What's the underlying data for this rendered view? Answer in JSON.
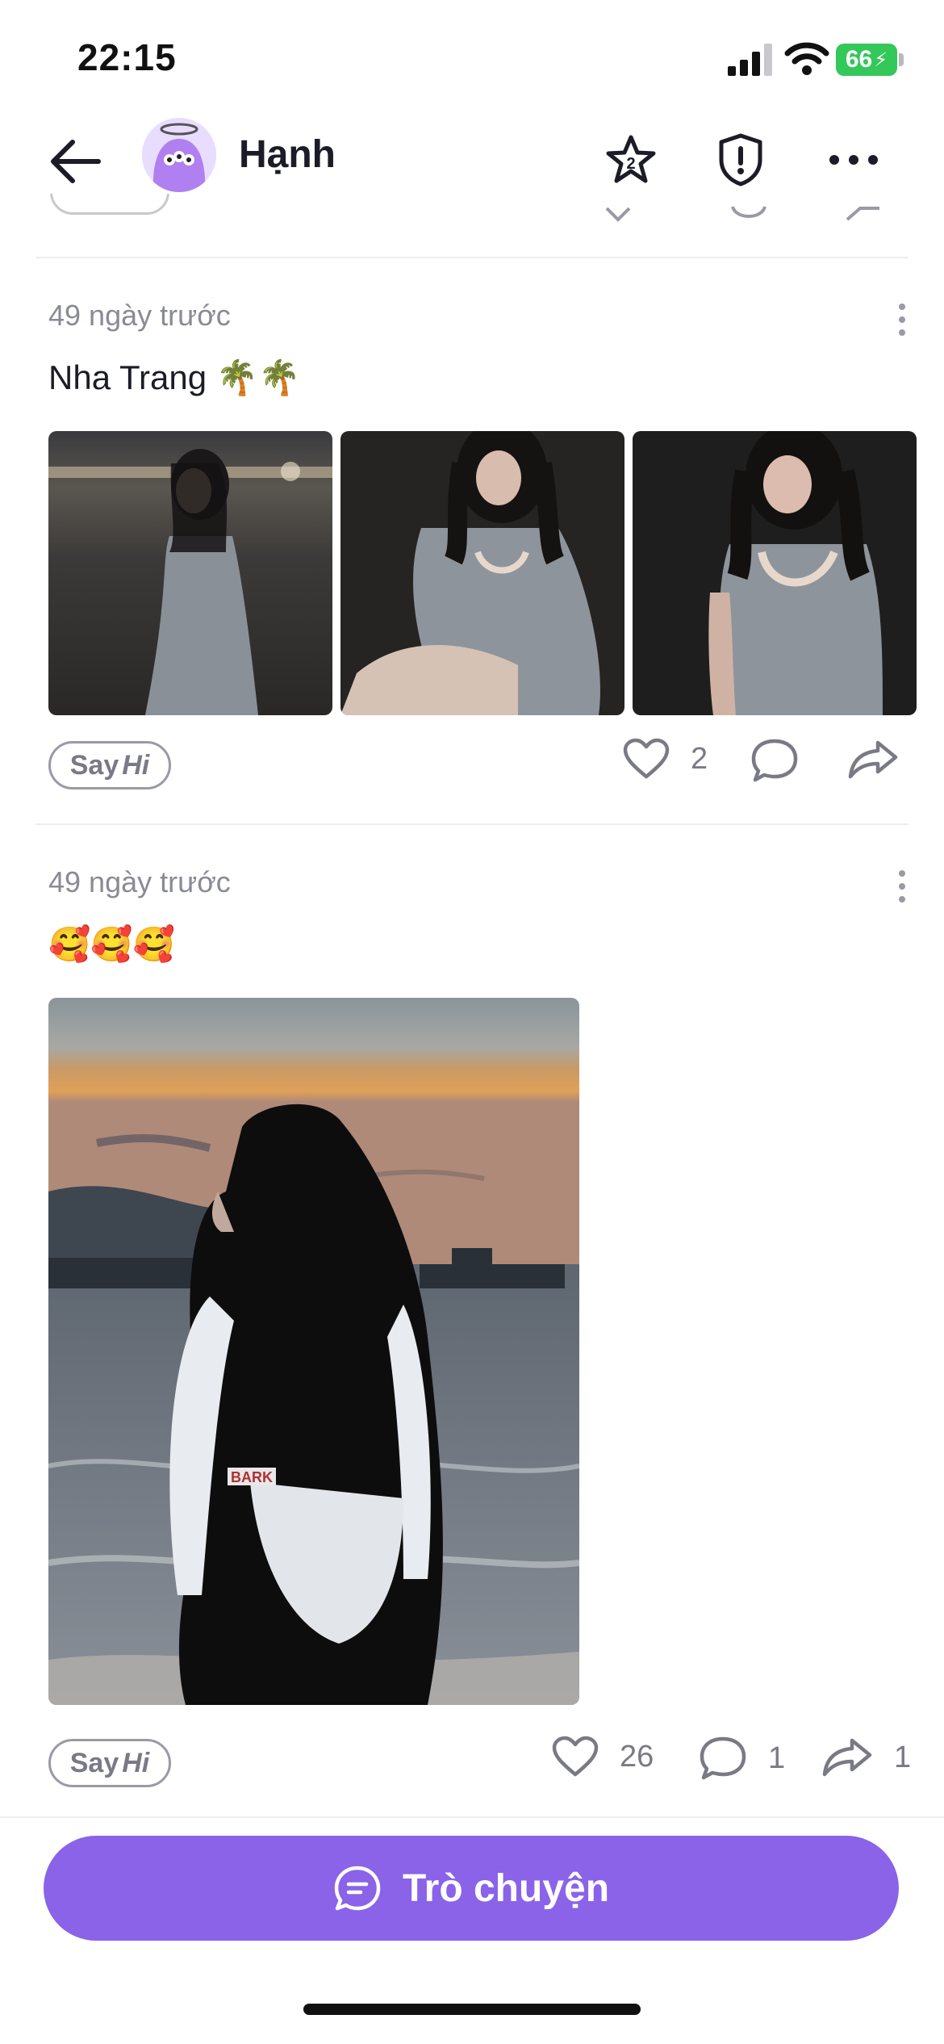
{
  "status_bar": {
    "time": "22:15",
    "battery": "66"
  },
  "header": {
    "name": "Hạnh"
  },
  "posts": [
    {
      "time": "49 ngày trước",
      "caption": "Nha Trang 🌴🌴",
      "sayhi_say": "Say",
      "sayhi_hi": "Hi",
      "likes": "2",
      "comments": "",
      "shares": ""
    },
    {
      "time": "49 ngày trước",
      "caption": "🥰🥰🥰",
      "sayhi_say": "Say",
      "sayhi_hi": "Hi",
      "likes": "26",
      "comments": "1",
      "shares": "1"
    }
  ],
  "bottom_bar": {
    "chat_label": "Trò chuyện"
  },
  "colors": {
    "accent": "#8a63e8",
    "battery": "#34c759",
    "muted": "#8a8a96"
  }
}
